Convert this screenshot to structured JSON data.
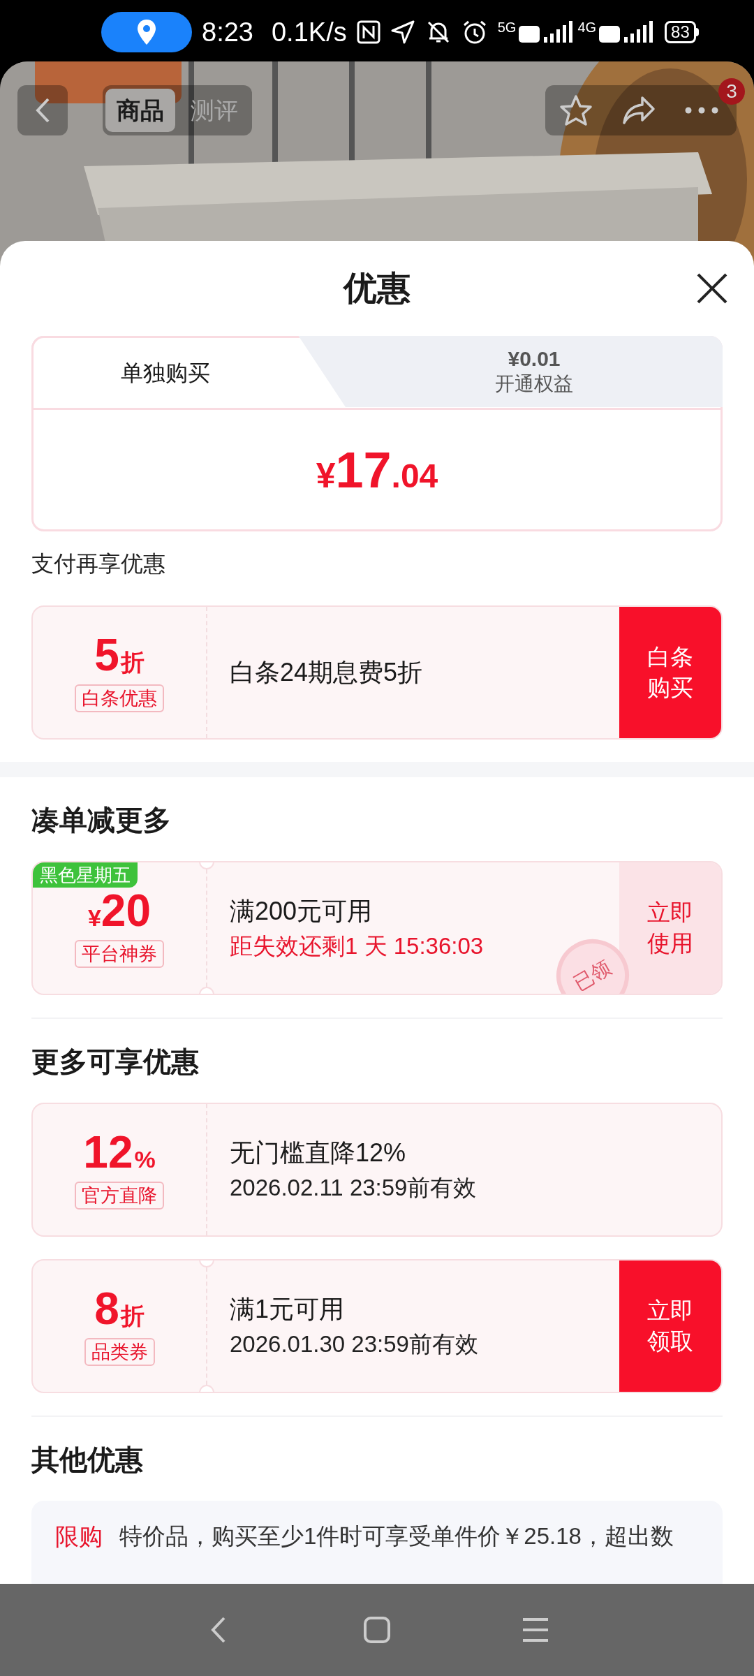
{
  "status_bar": {
    "time": "8:23",
    "network_speed": "0.1K/s",
    "battery": "83",
    "network_1": "5G",
    "network_2": "4G"
  },
  "header": {
    "tabs": [
      {
        "label": "商品",
        "selected": true
      },
      {
        "label": "测评",
        "selected": false
      }
    ],
    "badge": "3"
  },
  "sheet": {
    "title": "优惠"
  },
  "purchase_tabs": [
    {
      "label": "单独购买",
      "selected": true
    },
    {
      "price": "¥0.01",
      "label": "开通权益",
      "selected": false
    }
  ],
  "price": {
    "currency": "¥",
    "integer": "17",
    "decimal": ".04"
  },
  "sections": [
    {
      "heading": "支付再享优惠",
      "kind": "subheading",
      "coupons": [
        {
          "value": "5",
          "suffix": "折",
          "tag": "白条优惠",
          "title": "白条24期息费5折",
          "action": "白条购买",
          "action_filled": true,
          "notched": false
        }
      ]
    },
    {
      "heading": "凑单减更多",
      "kind": "heading",
      "coupons": [
        {
          "ribbon": "黑色星期五",
          "prefix": "¥",
          "value": "20",
          "tag": "平台神券",
          "title": "满200元可用",
          "subtitle": "距失效还剩1 天 15:36:03",
          "subtitle_highlight": true,
          "action": "立即使用",
          "action_filled": false,
          "stamp": "已领",
          "notched": true
        }
      ]
    },
    {
      "heading": "更多可享优惠",
      "kind": "heading",
      "coupons": [
        {
          "value": "12",
          "suffix": "%",
          "tag": "官方直降",
          "title": "无门槛直降12%",
          "subtitle": "2026.02.11 23:59前有效",
          "subtitle_highlight": false,
          "notched": false
        },
        {
          "value": "8",
          "suffix": "折",
          "tag": "品类券",
          "title": "满1元可用",
          "subtitle": "2026.01.30 23:59前有效",
          "subtitle_highlight": false,
          "action": "立即领取",
          "action_filled": true,
          "notched": true
        }
      ]
    },
    {
      "heading": "其他优惠",
      "kind": "heading",
      "notes": [
        {
          "tag": "限购",
          "text": "特价品，购买至少1件时可享受单件价￥25.18，超出数"
        }
      ]
    }
  ]
}
